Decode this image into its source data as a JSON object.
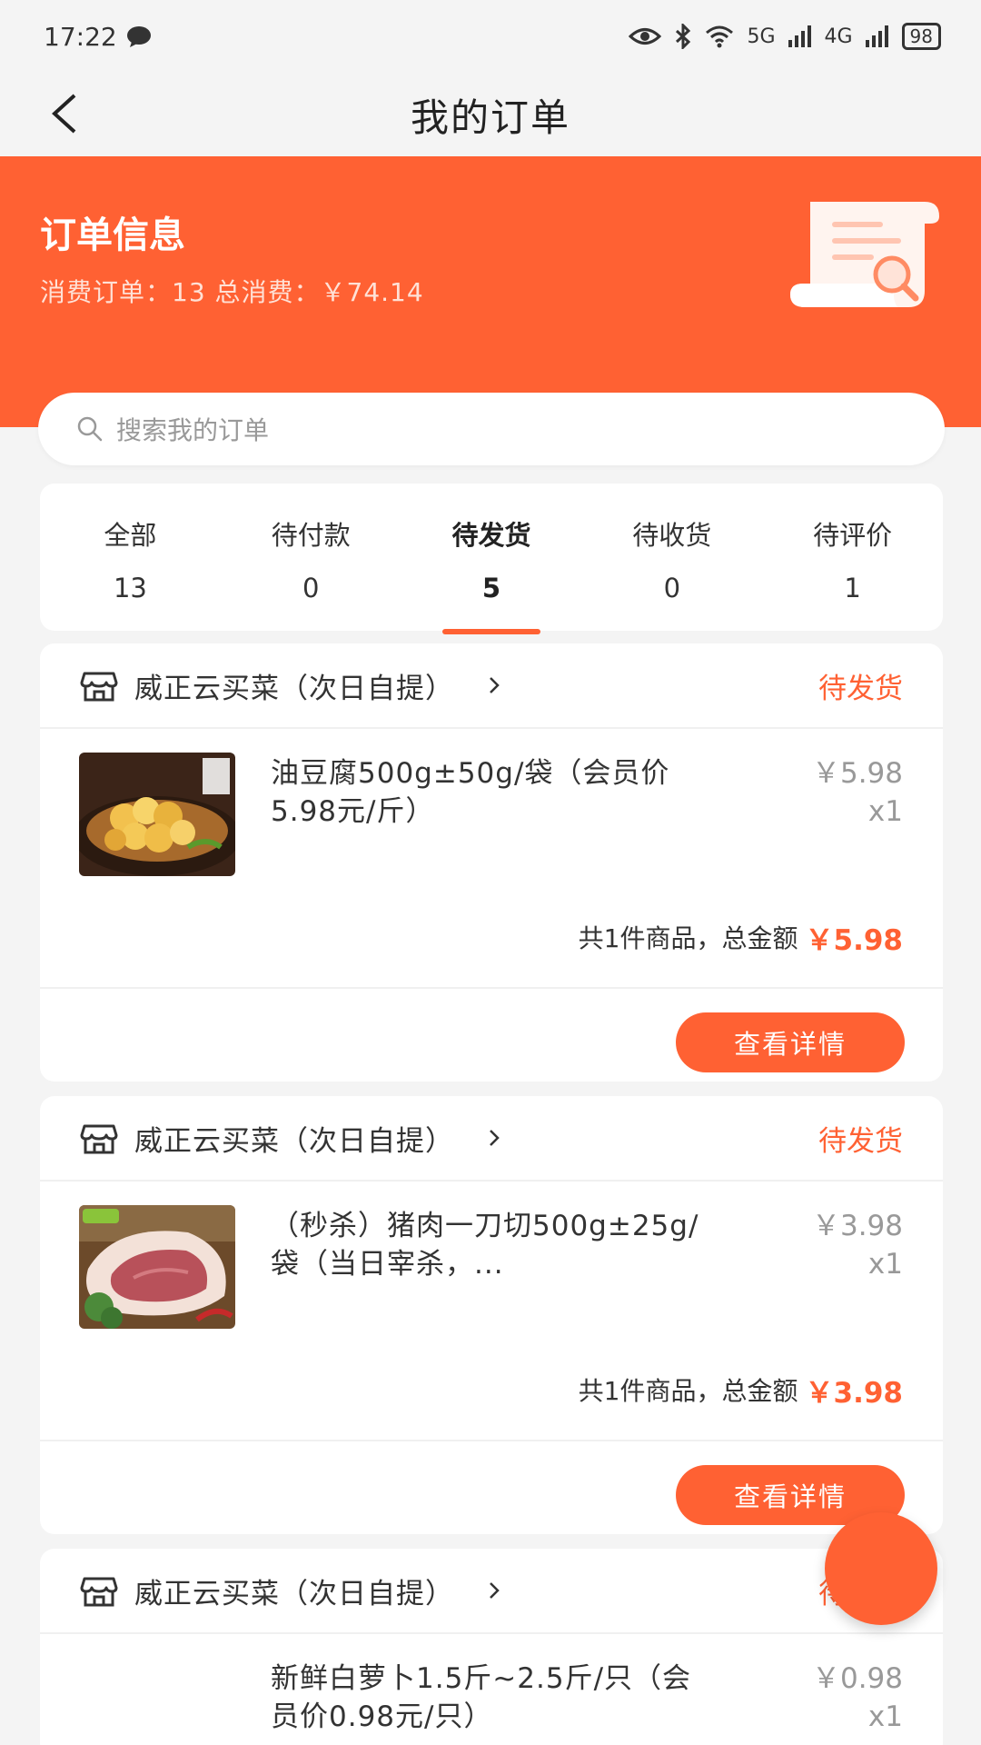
{
  "status_bar": {
    "time": "17:22",
    "network_1": "5G",
    "network_2": "4G",
    "battery": "98"
  },
  "header": {
    "title": "我的订单"
  },
  "order_info": {
    "title": "订单信息",
    "summary": "消费订单：13 总消费：￥74.14"
  },
  "search": {
    "placeholder": "搜索我的订单"
  },
  "tabs": [
    {
      "label": "全部",
      "count": "13"
    },
    {
      "label": "待付款",
      "count": "0"
    },
    {
      "label": "待发货",
      "count": "5"
    },
    {
      "label": "待收货",
      "count": "0"
    },
    {
      "label": "待评价",
      "count": "1"
    }
  ],
  "orders": [
    {
      "shop": "威正云买菜（次日自提）",
      "status": "待发货",
      "item_name": "油豆腐500g±50g/袋（会员价5.98元/斤）",
      "price": "￥5.98",
      "qty": "x1",
      "summary_text": "共1件商品，总金额",
      "total": "￥5.98",
      "button": "查看详情"
    },
    {
      "shop": "威正云买菜（次日自提）",
      "status": "待发货",
      "item_name": "（秒杀）猪肉一刀切500g±25g/袋（当日宰杀，...",
      "price": "￥3.98",
      "qty": "x1",
      "summary_text": "共1件商品，总金额",
      "total": "￥3.98",
      "button": "查看详情"
    },
    {
      "shop": "威正云买菜（次日自提）",
      "status": "待发货",
      "item_name": "新鲜白萝卜1.5斤~2.5斤/只（会员价0.98元/只）",
      "price": "￥0.98",
      "qty": "x1"
    }
  ],
  "colors": {
    "accent": "#ff6133",
    "background": "#f4f4f4"
  }
}
